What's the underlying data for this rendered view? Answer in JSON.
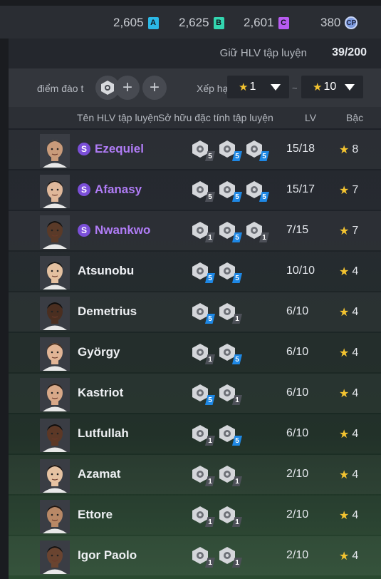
{
  "currencies": [
    {
      "value": "2,605",
      "badge": "A",
      "color": "#2bb8e6"
    },
    {
      "value": "2,625",
      "badge": "B",
      "color": "#33d6b0"
    },
    {
      "value": "2,601",
      "badge": "C",
      "color": "#b75bf0"
    },
    {
      "value": "380",
      "badge": "CP",
      "color": "#7d9be0"
    }
  ],
  "capacity": {
    "label": "Giữ HLV tập luyện",
    "value": "39/200"
  },
  "filter": {
    "label": "điểm đào t",
    "rank_label": "Xếp hạ",
    "min_rank": "1",
    "max_rank": "10",
    "separator": "~"
  },
  "headers": {
    "name": "Tên HLV tập luyện",
    "traits": "Sở hữu đặc tính tập luyện",
    "lv": "LV",
    "grade": "Bậc"
  },
  "coaches": [
    {
      "name": "Ezequiel",
      "special": true,
      "lv": "15/18",
      "grade": "8",
      "skin": "#c99b7a",
      "hair": "#3a3a3a",
      "skills": [
        {
          "level": "5",
          "tone": "grey"
        },
        {
          "level": "5",
          "tone": "blue"
        },
        {
          "level": "5",
          "tone": "blue"
        }
      ]
    },
    {
      "name": "Afanasy",
      "special": true,
      "lv": "15/17",
      "grade": "7",
      "skin": "#e0b89a",
      "hair": "#1e1a18",
      "skills": [
        {
          "level": "5",
          "tone": "grey"
        },
        {
          "level": "5",
          "tone": "blue"
        },
        {
          "level": "5",
          "tone": "blue"
        }
      ]
    },
    {
      "name": "Nwankwo",
      "special": true,
      "lv": "7/15",
      "grade": "7",
      "skin": "#5a3a28",
      "hair": "#111111",
      "skills": [
        {
          "level": "1",
          "tone": "grey"
        },
        {
          "level": "5",
          "tone": "blue"
        },
        {
          "level": "1",
          "tone": "grey"
        }
      ]
    },
    {
      "name": "Atsunobu",
      "special": false,
      "lv": "10/10",
      "grade": "4",
      "skin": "#e4c0a0",
      "hair": "#141414",
      "skills": [
        {
          "level": "5",
          "tone": "blue"
        },
        {
          "level": "5",
          "tone": "blue"
        }
      ]
    },
    {
      "name": "Demetrius",
      "special": false,
      "lv": "6/10",
      "grade": "4",
      "skin": "#4a2e20",
      "hair": "#0e0e0e",
      "skills": [
        {
          "level": "5",
          "tone": "blue"
        },
        {
          "level": "1",
          "tone": "grey"
        }
      ]
    },
    {
      "name": "György",
      "special": false,
      "lv": "6/10",
      "grade": "4",
      "skin": "#e2b596",
      "hair": "#4a3020",
      "skills": [
        {
          "level": "1",
          "tone": "grey"
        },
        {
          "level": "5",
          "tone": "blue"
        }
      ]
    },
    {
      "name": "Kastriot",
      "special": false,
      "lv": "6/10",
      "grade": "4",
      "skin": "#d8a888",
      "hair": "#2a1c14",
      "skills": [
        {
          "level": "5",
          "tone": "blue"
        },
        {
          "level": "1",
          "tone": "grey"
        }
      ]
    },
    {
      "name": "Lutfullah",
      "special": false,
      "lv": "6/10",
      "grade": "4",
      "skin": "#5c3826",
      "hair": "#0e0e0e",
      "skills": [
        {
          "level": "1",
          "tone": "grey"
        },
        {
          "level": "5",
          "tone": "blue"
        }
      ]
    },
    {
      "name": "Azamat",
      "special": false,
      "lv": "2/10",
      "grade": "4",
      "skin": "#e6c2a2",
      "hair": "#1a1412",
      "skills": [
        {
          "level": "1",
          "tone": "grey"
        },
        {
          "level": "1",
          "tone": "grey"
        }
      ]
    },
    {
      "name": "Ettore",
      "special": false,
      "lv": "2/10",
      "grade": "4",
      "skin": "#b88866",
      "hair": "#1e1612",
      "skills": [
        {
          "level": "1",
          "tone": "grey"
        },
        {
          "level": "1",
          "tone": "grey"
        }
      ]
    },
    {
      "name": "Igor Paolo",
      "special": false,
      "lv": "2/10",
      "grade": "4",
      "skin": "#6a4430",
      "hair": "#121212",
      "skills": [
        {
          "level": "1",
          "tone": "grey"
        },
        {
          "level": "1",
          "tone": "grey"
        }
      ]
    }
  ]
}
